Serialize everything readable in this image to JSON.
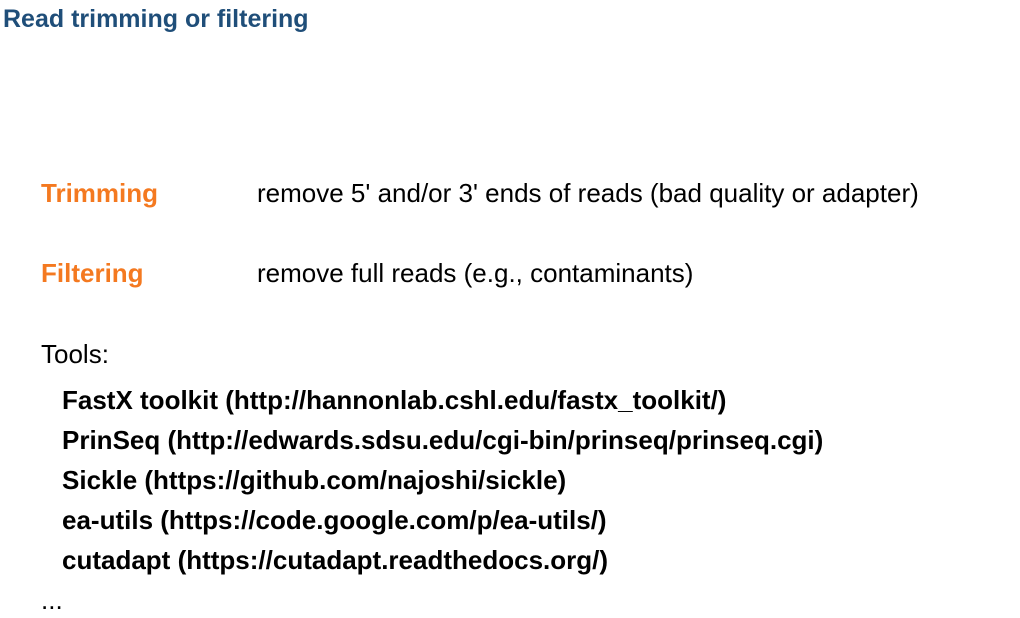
{
  "title": "Read trimming or filtering",
  "definitions": [
    {
      "term": "Trimming",
      "description": "remove 5' and/or 3' ends of reads (bad quality or adapter)"
    },
    {
      "term": "Filtering",
      "description": "remove full reads (e.g., contaminants)"
    }
  ],
  "tools_heading": "Tools:",
  "tools": [
    "FastX toolkit (http://hannonlab.cshl.edu/fastx_toolkit/)",
    "PrinSeq (http://edwards.sdsu.edu/cgi-bin/prinseq/prinseq.cgi)",
    "Sickle (https://github.com/najoshi/sickle)",
    "ea-utils (https://code.google.com/p/ea-utils/)",
    "cutadapt (https://cutadapt.readthedocs.org/)"
  ],
  "ellipsis": "...",
  "colors": {
    "title": "#1f4e79",
    "term": "#f47920"
  }
}
